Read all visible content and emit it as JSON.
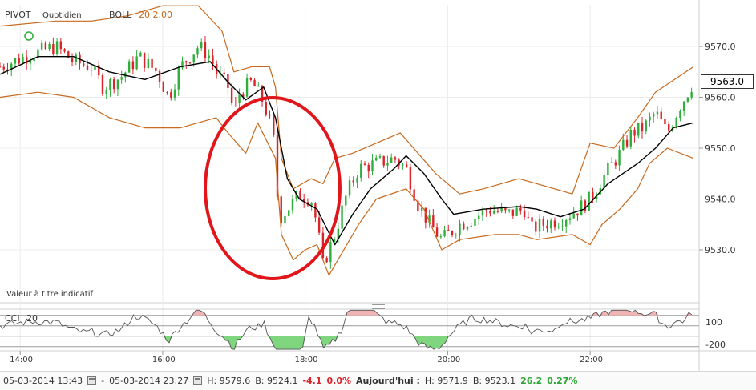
{
  "header": {
    "symbol": "PIVOT",
    "period": "Quotidien",
    "indicator": "BOLL",
    "indicator_params": "20  2.00"
  },
  "disclaimer": "Valeur à titre indicatif",
  "last_price_tag": "9563.0",
  "cci_panel": {
    "label": "CCI",
    "param": "20",
    "levels": [
      "100",
      "-200"
    ]
  },
  "status_bar": {
    "start": "05-03-2014 13:43",
    "separator": "-",
    "end": "05-03-2014 23:27",
    "high": "H: 9579.6",
    "low": "B: 9524.1",
    "change": "-4.1",
    "change_pct": "0.0%",
    "today_label": "Aujourd'hui :",
    "today_high": "H: 9571.9",
    "today_low": "B: 9523.1",
    "today_change": "26.2",
    "today_change_pct": "0.27%"
  },
  "colors": {
    "up": "#2fae3a",
    "down": "#d9242b",
    "bollinger_band": "#c8691e",
    "moving_average": "#000000",
    "annotation_circle": "#e0161b",
    "cci_positive_fill": "#f0b4b4",
    "cci_negative_fill": "#7fd67f"
  },
  "chart_data": [
    {
      "type": "candlestick",
      "title": "PIVOT Quotidien",
      "x_ticks": [
        "14:00",
        "16:00",
        "18:00",
        "20:00",
        "22:00"
      ],
      "y_ticks": [
        "9530.0",
        "9540.0",
        "9550.0",
        "9560.0",
        "9570.0"
      ],
      "ylim": [
        9522,
        9578
      ],
      "grid": true,
      "overlays": [
        "Bollinger upper band",
        "Bollinger middle (MA20)",
        "Bollinger lower band"
      ],
      "annotation": "red ellipse highlighting the drop around 17:00–18:10",
      "close_path": [
        [
          "13:43",
          9566
        ],
        [
          "14:10",
          9568.5
        ],
        [
          "14:30",
          9570
        ],
        [
          "14:45",
          9567
        ],
        [
          "15:00",
          9566
        ],
        [
          "15:10",
          9562
        ],
        [
          "15:25",
          9564
        ],
        [
          "15:40",
          9568
        ],
        [
          "15:55",
          9565
        ],
        [
          "16:05",
          9560
        ],
        [
          "16:15",
          9566
        ],
        [
          "16:30",
          9570
        ],
        [
          "16:40",
          9568
        ],
        [
          "16:45",
          9565
        ],
        [
          "16:55",
          9562
        ],
        [
          "17:00",
          9557
        ],
        [
          "17:05",
          9561
        ],
        [
          "17:15",
          9563
        ],
        [
          "17:25",
          9559
        ],
        [
          "17:33",
          9553
        ],
        [
          "17:38",
          9536
        ],
        [
          "17:45",
          9538
        ],
        [
          "17:55",
          9541
        ],
        [
          "18:05",
          9540
        ],
        [
          "18:10",
          9535
        ],
        [
          "18:15",
          9527
        ],
        [
          "18:25",
          9533
        ],
        [
          "18:35",
          9541
        ],
        [
          "18:45",
          9546
        ],
        [
          "19:00",
          9547
        ],
        [
          "19:15",
          9548
        ],
        [
          "19:25",
          9546
        ],
        [
          "19:35",
          9539
        ],
        [
          "19:45",
          9535
        ],
        [
          "19:55",
          9532
        ],
        [
          "20:10",
          9535
        ],
        [
          "20:20",
          9536
        ],
        [
          "20:35",
          9538
        ],
        [
          "20:50",
          9537
        ],
        [
          "21:05",
          9538
        ],
        [
          "21:10",
          9534
        ],
        [
          "21:20",
          9535
        ],
        [
          "21:35",
          9536
        ],
        [
          "21:50",
          9538
        ],
        [
          "22:00",
          9540
        ],
        [
          "22:10",
          9544
        ],
        [
          "22:25",
          9549
        ],
        [
          "22:35",
          9553
        ],
        [
          "22:45",
          9554
        ],
        [
          "22:55",
          9557
        ],
        [
          "23:05",
          9553
        ],
        [
          "23:15",
          9558
        ],
        [
          "23:27",
          9563
        ]
      ],
      "bollinger_upper": [
        [
          "13:43",
          9574
        ],
        [
          "14:30",
          9575
        ],
        [
          "15:00",
          9575
        ],
        [
          "15:30",
          9576
        ],
        [
          "16:00",
          9578
        ],
        [
          "16:30",
          9578
        ],
        [
          "16:50",
          9573
        ],
        [
          "17:00",
          9565
        ],
        [
          "17:15",
          9566
        ],
        [
          "17:30",
          9566
        ],
        [
          "17:35",
          9562
        ],
        [
          "17:40",
          9548
        ],
        [
          "17:50",
          9542
        ],
        [
          "18:05",
          9544
        ],
        [
          "18:15",
          9543
        ],
        [
          "18:25",
          9548
        ],
        [
          "18:40",
          9549
        ],
        [
          "19:00",
          9551
        ],
        [
          "19:20",
          9553
        ],
        [
          "19:35",
          9549
        ],
        [
          "19:50",
          9545
        ],
        [
          "20:10",
          9541
        ],
        [
          "20:30",
          9542
        ],
        [
          "21:00",
          9544
        ],
        [
          "21:30",
          9542
        ],
        [
          "21:45",
          9541
        ],
        [
          "22:00",
          9551
        ],
        [
          "22:20",
          9550
        ],
        [
          "22:40",
          9556
        ],
        [
          "22:55",
          9561
        ],
        [
          "23:27",
          9566
        ]
      ],
      "bollinger_middle": [
        [
          "13:43",
          9564.5
        ],
        [
          "14:15",
          9568
        ],
        [
          "14:45",
          9568
        ],
        [
          "15:15",
          9565
        ],
        [
          "15:45",
          9563.5
        ],
        [
          "16:15",
          9566
        ],
        [
          "16:40",
          9567
        ],
        [
          "16:55",
          9563
        ],
        [
          "17:10",
          9559.5
        ],
        [
          "17:25",
          9562
        ],
        [
          "17:35",
          9556
        ],
        [
          "17:45",
          9544
        ],
        [
          "17:55",
          9540
        ],
        [
          "18:10",
          9538
        ],
        [
          "18:25",
          9531
        ],
        [
          "18:40",
          9537
        ],
        [
          "18:55",
          9542
        ],
        [
          "19:15",
          9546
        ],
        [
          "19:25",
          9548.5
        ],
        [
          "19:40",
          9545
        ],
        [
          "19:55",
          9540
        ],
        [
          "20:05",
          9537
        ],
        [
          "20:30",
          9538
        ],
        [
          "21:00",
          9538.5
        ],
        [
          "21:15",
          9538
        ],
        [
          "21:35",
          9536.5
        ],
        [
          "21:55",
          9538
        ],
        [
          "22:15",
          9543
        ],
        [
          "22:40",
          9547
        ],
        [
          "22:55",
          9550
        ],
        [
          "23:10",
          9554
        ],
        [
          "23:27",
          9555
        ]
      ],
      "bollinger_lower": [
        [
          "13:43",
          9560
        ],
        [
          "14:15",
          9561
        ],
        [
          "14:45",
          9560
        ],
        [
          "15:15",
          9556
        ],
        [
          "15:45",
          9554
        ],
        [
          "16:15",
          9554
        ],
        [
          "16:45",
          9556
        ],
        [
          "16:55",
          9553
        ],
        [
          "17:10",
          9549
        ],
        [
          "17:20",
          9555
        ],
        [
          "17:35",
          9548
        ],
        [
          "17:40",
          9533
        ],
        [
          "17:50",
          9528
        ],
        [
          "18:00",
          9530
        ],
        [
          "18:10",
          9531
        ],
        [
          "18:20",
          9525
        ],
        [
          "18:30",
          9529
        ],
        [
          "18:45",
          9535
        ],
        [
          "19:00",
          9540
        ],
        [
          "19:25",
          9542
        ],
        [
          "19:40",
          9538
        ],
        [
          "19:55",
          9530
        ],
        [
          "20:10",
          9532
        ],
        [
          "20:40",
          9533
        ],
        [
          "21:00",
          9533
        ],
        [
          "21:15",
          9532
        ],
        [
          "21:45",
          9533
        ],
        [
          "22:00",
          9531
        ],
        [
          "22:10",
          9535
        ],
        [
          "22:25",
          9538
        ],
        [
          "22:40",
          9542
        ],
        [
          "22:50",
          9547
        ],
        [
          "23:05",
          9550
        ],
        [
          "23:27",
          9548
        ]
      ]
    },
    {
      "type": "area",
      "title": "CCI 20",
      "y_ticks": [
        "100",
        "-200"
      ],
      "reference_lines": [
        100,
        0,
        -100,
        -200
      ],
      "ylim": [
        -240,
        160
      ],
      "note": "oscillator shaded red above +100 and green below -100"
    }
  ]
}
